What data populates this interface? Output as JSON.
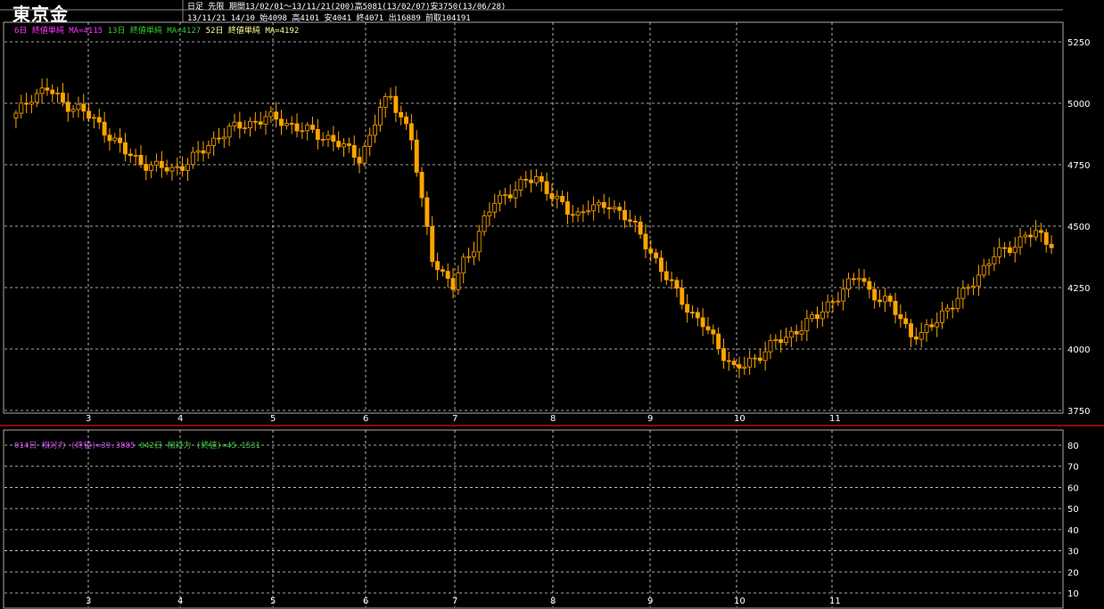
{
  "header": {
    "title": "東京金",
    "line1": "日足 先限 期間13/02/01～13/11/21(200)高5081(13/02/07)安3750(13/06/28)",
    "line2": "13/11/21 14/10 始4098 高4101 安4041 終4071 出16889 前取104191"
  },
  "colors": {
    "up": "#ffa500",
    "down": "#ffa500",
    "ma6": "#ff33ff",
    "ma13": "#33cc33",
    "ma52": "#ffff99",
    "rsi14": "#cc44ee",
    "rsi42": "#33cc33",
    "grid": "#ffffff",
    "separator": "#cc0000"
  },
  "chart_data": [
    {
      "type": "candlestick",
      "legend": [
        {
          "label": "6日 終値単純 MA=4115",
          "color": "#ff33ff"
        },
        {
          "label": "13日 終値単純 MA=4127",
          "color": "#33cc33"
        },
        {
          "label": "52日 終値単純 MA=4192",
          "color": "#ffff99"
        }
      ],
      "x_ticks": [
        "3",
        "4",
        "5",
        "6",
        "7",
        "8",
        "9",
        "10",
        "11"
      ],
      "y_ticks": [
        3750,
        4000,
        4250,
        4500,
        4750,
        5000,
        5250
      ],
      "ylim": [
        3750,
        5250
      ],
      "close_path": [
        [
          0,
          4950
        ],
        [
          3,
          5030
        ],
        [
          6,
          5060
        ],
        [
          9,
          5000
        ],
        [
          12,
          4980
        ],
        [
          15,
          4930
        ],
        [
          18,
          4870
        ],
        [
          21,
          4800
        ],
        [
          24,
          4760
        ],
        [
          27,
          4740
        ],
        [
          30,
          4730
        ],
        [
          33,
          4760
        ],
        [
          36,
          4810
        ],
        [
          39,
          4870
        ],
        [
          42,
          4900
        ],
        [
          45,
          4920
        ],
        [
          48,
          4940
        ],
        [
          51,
          4930
        ],
        [
          54,
          4900
        ],
        [
          57,
          4880
        ],
        [
          60,
          4860
        ],
        [
          63,
          4820
        ],
        [
          66,
          4780
        ],
        [
          68,
          4860
        ],
        [
          70,
          4980
        ],
        [
          72,
          5030
        ],
        [
          74,
          4950
        ],
        [
          76,
          4850
        ],
        [
          78,
          4600
        ],
        [
          80,
          4380
        ],
        [
          82,
          4300
        ],
        [
          84,
          4250
        ],
        [
          86,
          4360
        ],
        [
          88,
          4420
        ],
        [
          90,
          4520
        ],
        [
          92,
          4600
        ],
        [
          94,
          4630
        ],
        [
          96,
          4650
        ],
        [
          98,
          4680
        ],
        [
          100,
          4700
        ],
        [
          102,
          4650
        ],
        [
          104,
          4600
        ],
        [
          106,
          4560
        ],
        [
          108,
          4550
        ],
        [
          110,
          4580
        ],
        [
          112,
          4570
        ],
        [
          114,
          4590
        ],
        [
          116,
          4560
        ],
        [
          118,
          4520
        ],
        [
          120,
          4460
        ],
        [
          122,
          4400
        ],
        [
          124,
          4320
        ],
        [
          126,
          4260
        ],
        [
          128,
          4200
        ],
        [
          130,
          4140
        ],
        [
          132,
          4100
        ],
        [
          134,
          4040
        ],
        [
          136,
          3980
        ],
        [
          138,
          3920
        ],
        [
          140,
          3930
        ],
        [
          142,
          3960
        ],
        [
          144,
          4000
        ],
        [
          146,
          4030
        ],
        [
          148,
          4040
        ],
        [
          150,
          4080
        ],
        [
          152,
          4110
        ],
        [
          154,
          4130
        ],
        [
          156,
          4180
        ],
        [
          158,
          4220
        ],
        [
          160,
          4260
        ],
        [
          162,
          4300
        ],
        [
          164,
          4240
        ],
        [
          166,
          4200
        ],
        [
          168,
          4180
        ],
        [
          170,
          4130
        ],
        [
          172,
          4060
        ],
        [
          174,
          4050
        ],
        [
          176,
          4100
        ],
        [
          178,
          4150
        ],
        [
          180,
          4180
        ],
        [
          182,
          4220
        ],
        [
          184,
          4280
        ],
        [
          186,
          4330
        ],
        [
          188,
          4380
        ],
        [
          190,
          4400
        ],
        [
          192,
          4430
        ],
        [
          194,
          4460
        ],
        [
          196,
          4470
        ],
        [
          198,
          4440
        ]
      ]
    },
    {
      "type": "line",
      "legend": [
        {
          "label": "014日 相対力 (終値)=39.3885",
          "color": "#cc44ee"
        },
        {
          "label": "042日 相対力 (終値)=45.1531",
          "color": "#33cc33"
        }
      ],
      "x_ticks": [
        "3",
        "4",
        "5",
        "6",
        "7",
        "8",
        "9",
        "10",
        "11"
      ],
      "y_ticks": [
        10,
        20,
        30,
        40,
        50,
        60,
        70,
        80
      ],
      "ylim": [
        10,
        80
      ]
    }
  ]
}
